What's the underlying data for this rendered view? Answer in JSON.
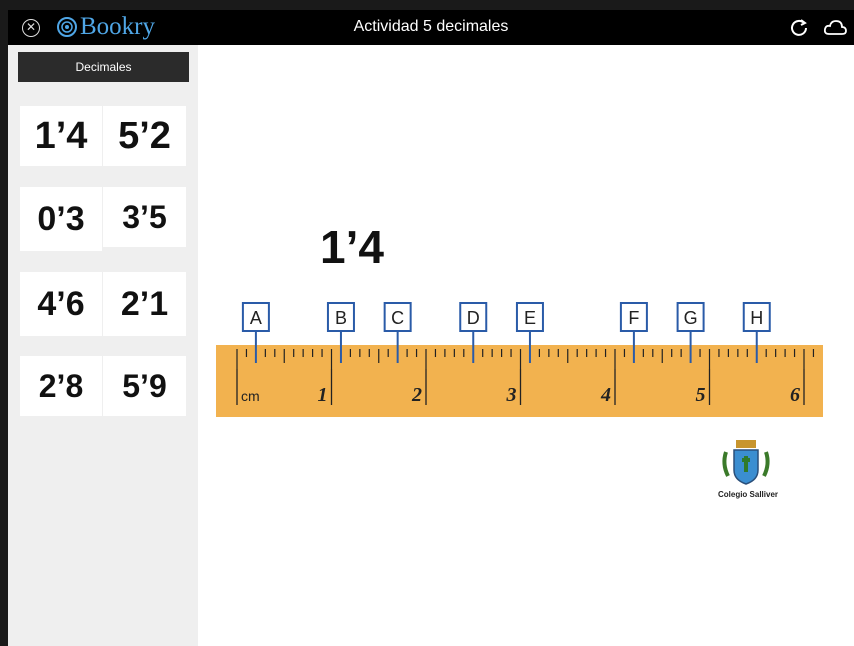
{
  "app": {
    "logo_text": "Bookry",
    "title": "Actividad 5 decimales"
  },
  "sidebar": {
    "header": "Decimales",
    "cards": [
      "1’4",
      "5’2",
      "0’3",
      "3’5",
      "4’6",
      "2’1",
      "2’8",
      "5’9"
    ]
  },
  "main": {
    "current_number": "1’4",
    "ruler": {
      "unit_label": "cm",
      "numbers": [
        "1",
        "2",
        "3",
        "4",
        "5",
        "6"
      ],
      "markers": [
        "A",
        "B",
        "C",
        "D",
        "E",
        "F",
        "G",
        "H"
      ],
      "marker_values": [
        0.2,
        1.1,
        1.7,
        2.5,
        3.1,
        4.2,
        4.8,
        5.5
      ],
      "background_color": "#f2b24f",
      "marker_color": "#2a5ba8"
    },
    "school_name": "Colegio Salliver"
  }
}
